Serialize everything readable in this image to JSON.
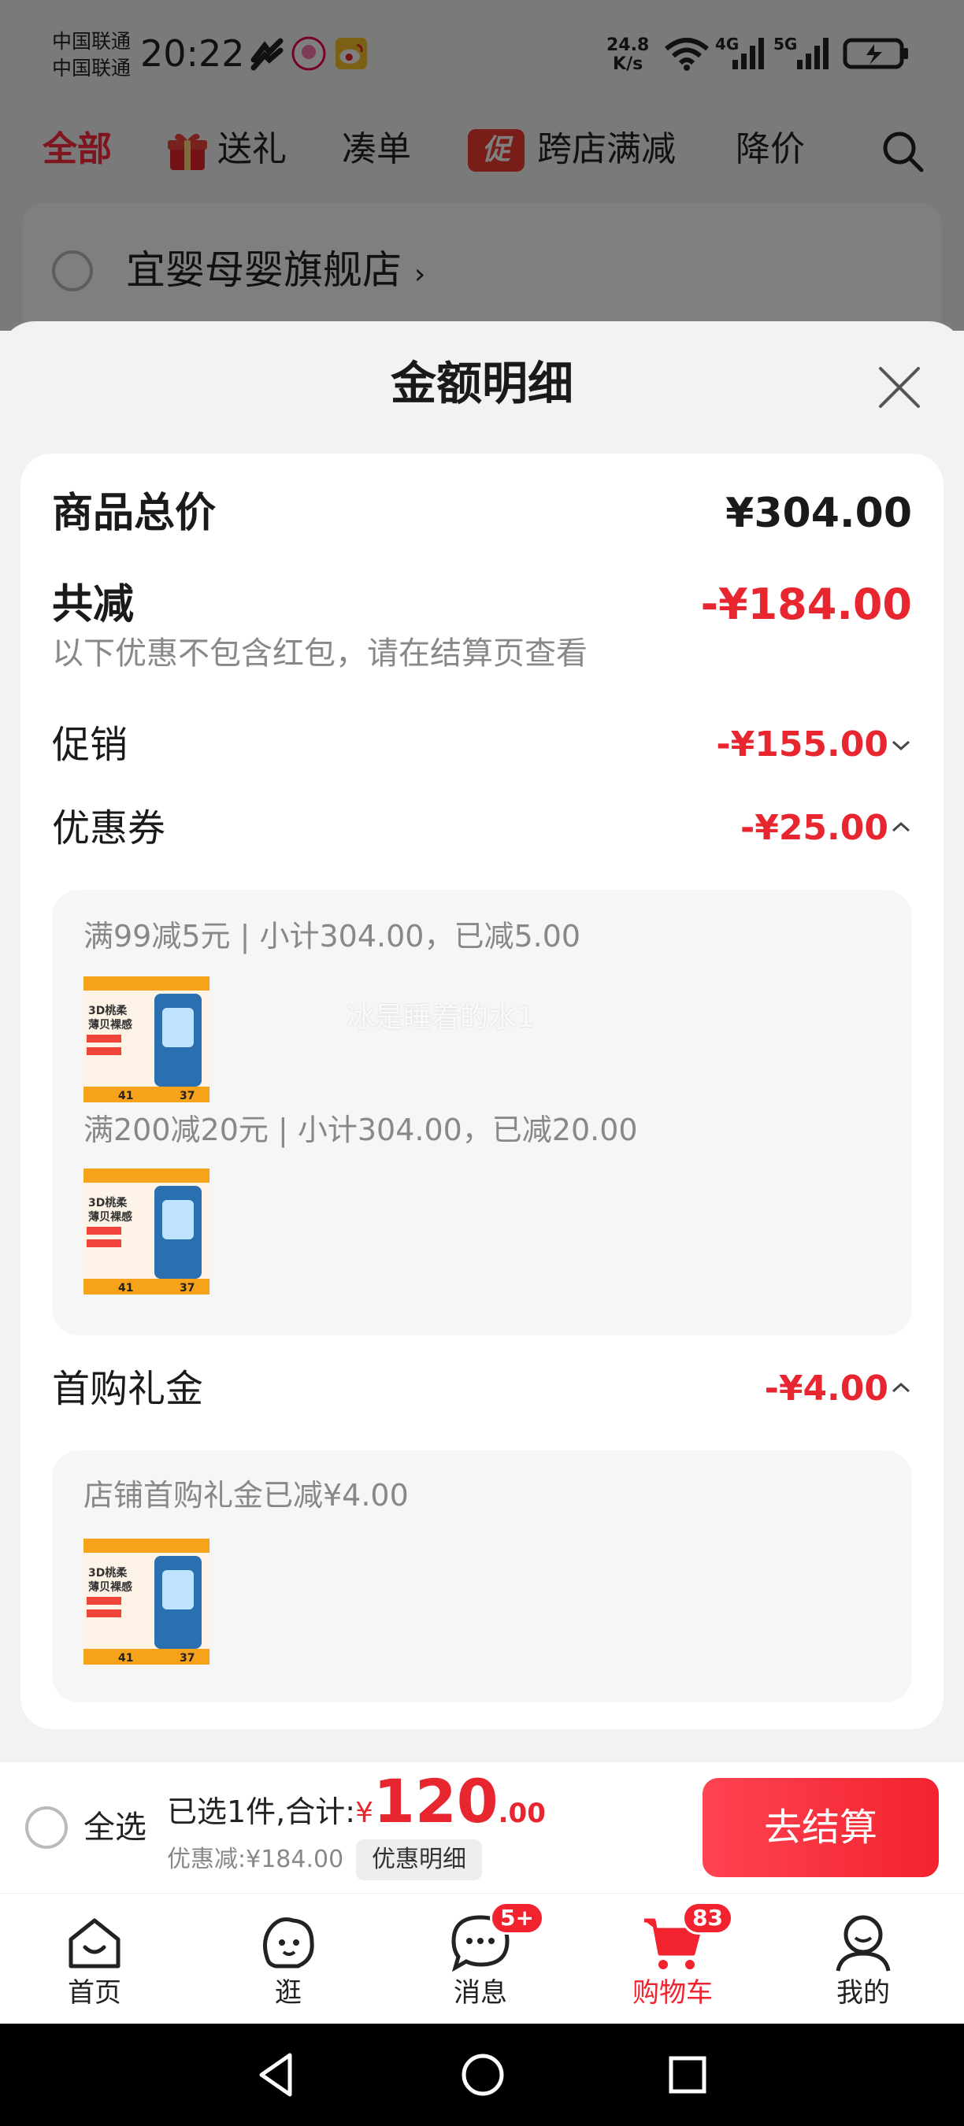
{
  "status_bar": {
    "carrier_1": "中国联通",
    "carrier_2": "中国联通",
    "time": "20:22",
    "net_speed_value": "24.8",
    "net_speed_unit": "K/s",
    "net_4g": "4G",
    "net_5g": "5G"
  },
  "top_tabs": {
    "all": "全部",
    "gift": "送礼",
    "bundle": "凑单",
    "promo_badge": "促",
    "cross_store": "跨店满减",
    "price_drop": "降价"
  },
  "store": {
    "name": "宜婴母婴旗舰店",
    "chevron": "›"
  },
  "sheet": {
    "title": "金额明细",
    "total_label": "商品总价",
    "total_value": "¥304.00",
    "reduce_label": "共减",
    "reduce_value": "-¥184.00",
    "reduce_note": "以下优惠不包含红包，请在结算页查看",
    "promo_label": "促销",
    "promo_value": "-¥155.00",
    "coupon_label": "优惠券",
    "coupon_value": "-¥25.00",
    "coupons": [
      {
        "text": "满99减5元 | 小计304.00，已减5.00"
      },
      {
        "text": "满200减20元 | 小计304.00，已减20.00"
      }
    ],
    "watermark": "冰是睡着的水1",
    "first_buy_label": "首购礼金",
    "first_buy_value": "-¥4.00",
    "first_buy_note": "店铺首购礼金已减¥4.00"
  },
  "product_thumb": {
    "headline_1": "3D桃柔",
    "headline_2": "薄贝裸感",
    "num_1": "41",
    "num_2": "37"
  },
  "checkout": {
    "select_all": "全选",
    "selected_text": "已选1件,合计:",
    "yen": "¥",
    "total_int": "120",
    "total_dec": ".00",
    "discount_text": "优惠减:¥184.00",
    "detail_chip": "优惠明细",
    "checkout_button": "去结算"
  },
  "tab_bar": {
    "tabs": [
      {
        "label": "首页",
        "icon": "home-icon"
      },
      {
        "label": "逛",
        "icon": "browse-icon"
      },
      {
        "label": "消息",
        "icon": "message-icon",
        "badge": "5+"
      },
      {
        "label": "购物车",
        "icon": "cart-icon",
        "badge": "83"
      },
      {
        "label": "我的",
        "icon": "profile-icon"
      }
    ]
  },
  "colors": {
    "accent_red": "#e8262f",
    "button_red": "#f2232e"
  }
}
